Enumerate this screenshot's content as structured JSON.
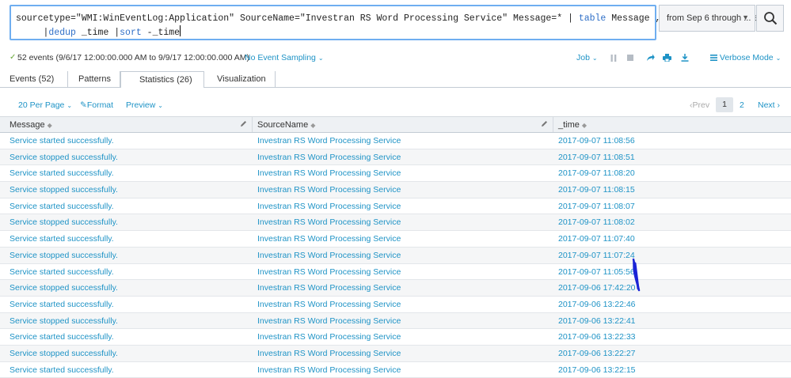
{
  "search": {
    "query_line1_a": "sourcetype=\"WMI:WinEventLog:Application\" SourceName=\"Investran RS Word Processing Service\" Message=* | ",
    "query_line1_kw": "table",
    "query_line1_b": " Message , SourceName  _time",
    "query_line2_pre": "     |",
    "query_line2_kw1": "dedup",
    "query_line2_mid": " _time |",
    "query_line2_kw2": "sort",
    "query_line2_post": " -_time",
    "time_range": "from Sep 6 through ...",
    "search_button_icon": "search-icon"
  },
  "status": {
    "events": "52 events (9/6/17 12:00:00.000 AM to 9/9/17 12:00:00.000 AM)",
    "sampling": "No Event Sampling",
    "job": "Job",
    "mode": "Verbose Mode"
  },
  "tabs": [
    {
      "label": "Events (52)"
    },
    {
      "label": "Patterns"
    },
    {
      "label": "Statistics (26)"
    },
    {
      "label": "Visualization"
    }
  ],
  "toolbar": {
    "per_page": "20 Per Page",
    "format": "Format",
    "preview": "Preview",
    "prev": "Prev",
    "page1": "1",
    "page2": "2",
    "next": "Next"
  },
  "table": {
    "columns": [
      "Message",
      "SourceName",
      "_time"
    ],
    "rows": [
      [
        "Service started successfully.",
        "Investran RS Word Processing Service",
        "2017-09-07 11:08:56"
      ],
      [
        "Service stopped successfully.",
        "Investran RS Word Processing Service",
        "2017-09-07 11:08:51"
      ],
      [
        "Service started successfully.",
        "Investran RS Word Processing Service",
        "2017-09-07 11:08:20"
      ],
      [
        "Service stopped successfully.",
        "Investran RS Word Processing Service",
        "2017-09-07 11:08:15"
      ],
      [
        "Service started successfully.",
        "Investran RS Word Processing Service",
        "2017-09-07 11:08:07"
      ],
      [
        "Service stopped successfully.",
        "Investran RS Word Processing Service",
        "2017-09-07 11:08:02"
      ],
      [
        "Service started successfully.",
        "Investran RS Word Processing Service",
        "2017-09-07 11:07:40"
      ],
      [
        "Service stopped successfully.",
        "Investran RS Word Processing Service",
        "2017-09-07 11:07:24"
      ],
      [
        "Service started successfully.",
        "Investran RS Word Processing Service",
        "2017-09-07 11:05:56"
      ],
      [
        "Service stopped successfully.",
        "Investran RS Word Processing Service",
        "2017-09-06 17:42:20"
      ],
      [
        "Service started successfully.",
        "Investran RS Word Processing Service",
        "2017-09-06 13:22:46"
      ],
      [
        "Service stopped successfully.",
        "Investran RS Word Processing Service",
        "2017-09-06 13:22:41"
      ],
      [
        "Service started successfully.",
        "Investran RS Word Processing Service",
        "2017-09-06 13:22:33"
      ],
      [
        "Service stopped successfully.",
        "Investran RS Word Processing Service",
        "2017-09-06 13:22:27"
      ],
      [
        "Service started successfully.",
        "Investran RS Word Processing Service",
        "2017-09-06 13:22:15"
      ]
    ]
  },
  "colors": {
    "link": "#1e93c6",
    "success": "#65a637",
    "search_border": "#6faef0",
    "annotation": "#1a24d6"
  }
}
